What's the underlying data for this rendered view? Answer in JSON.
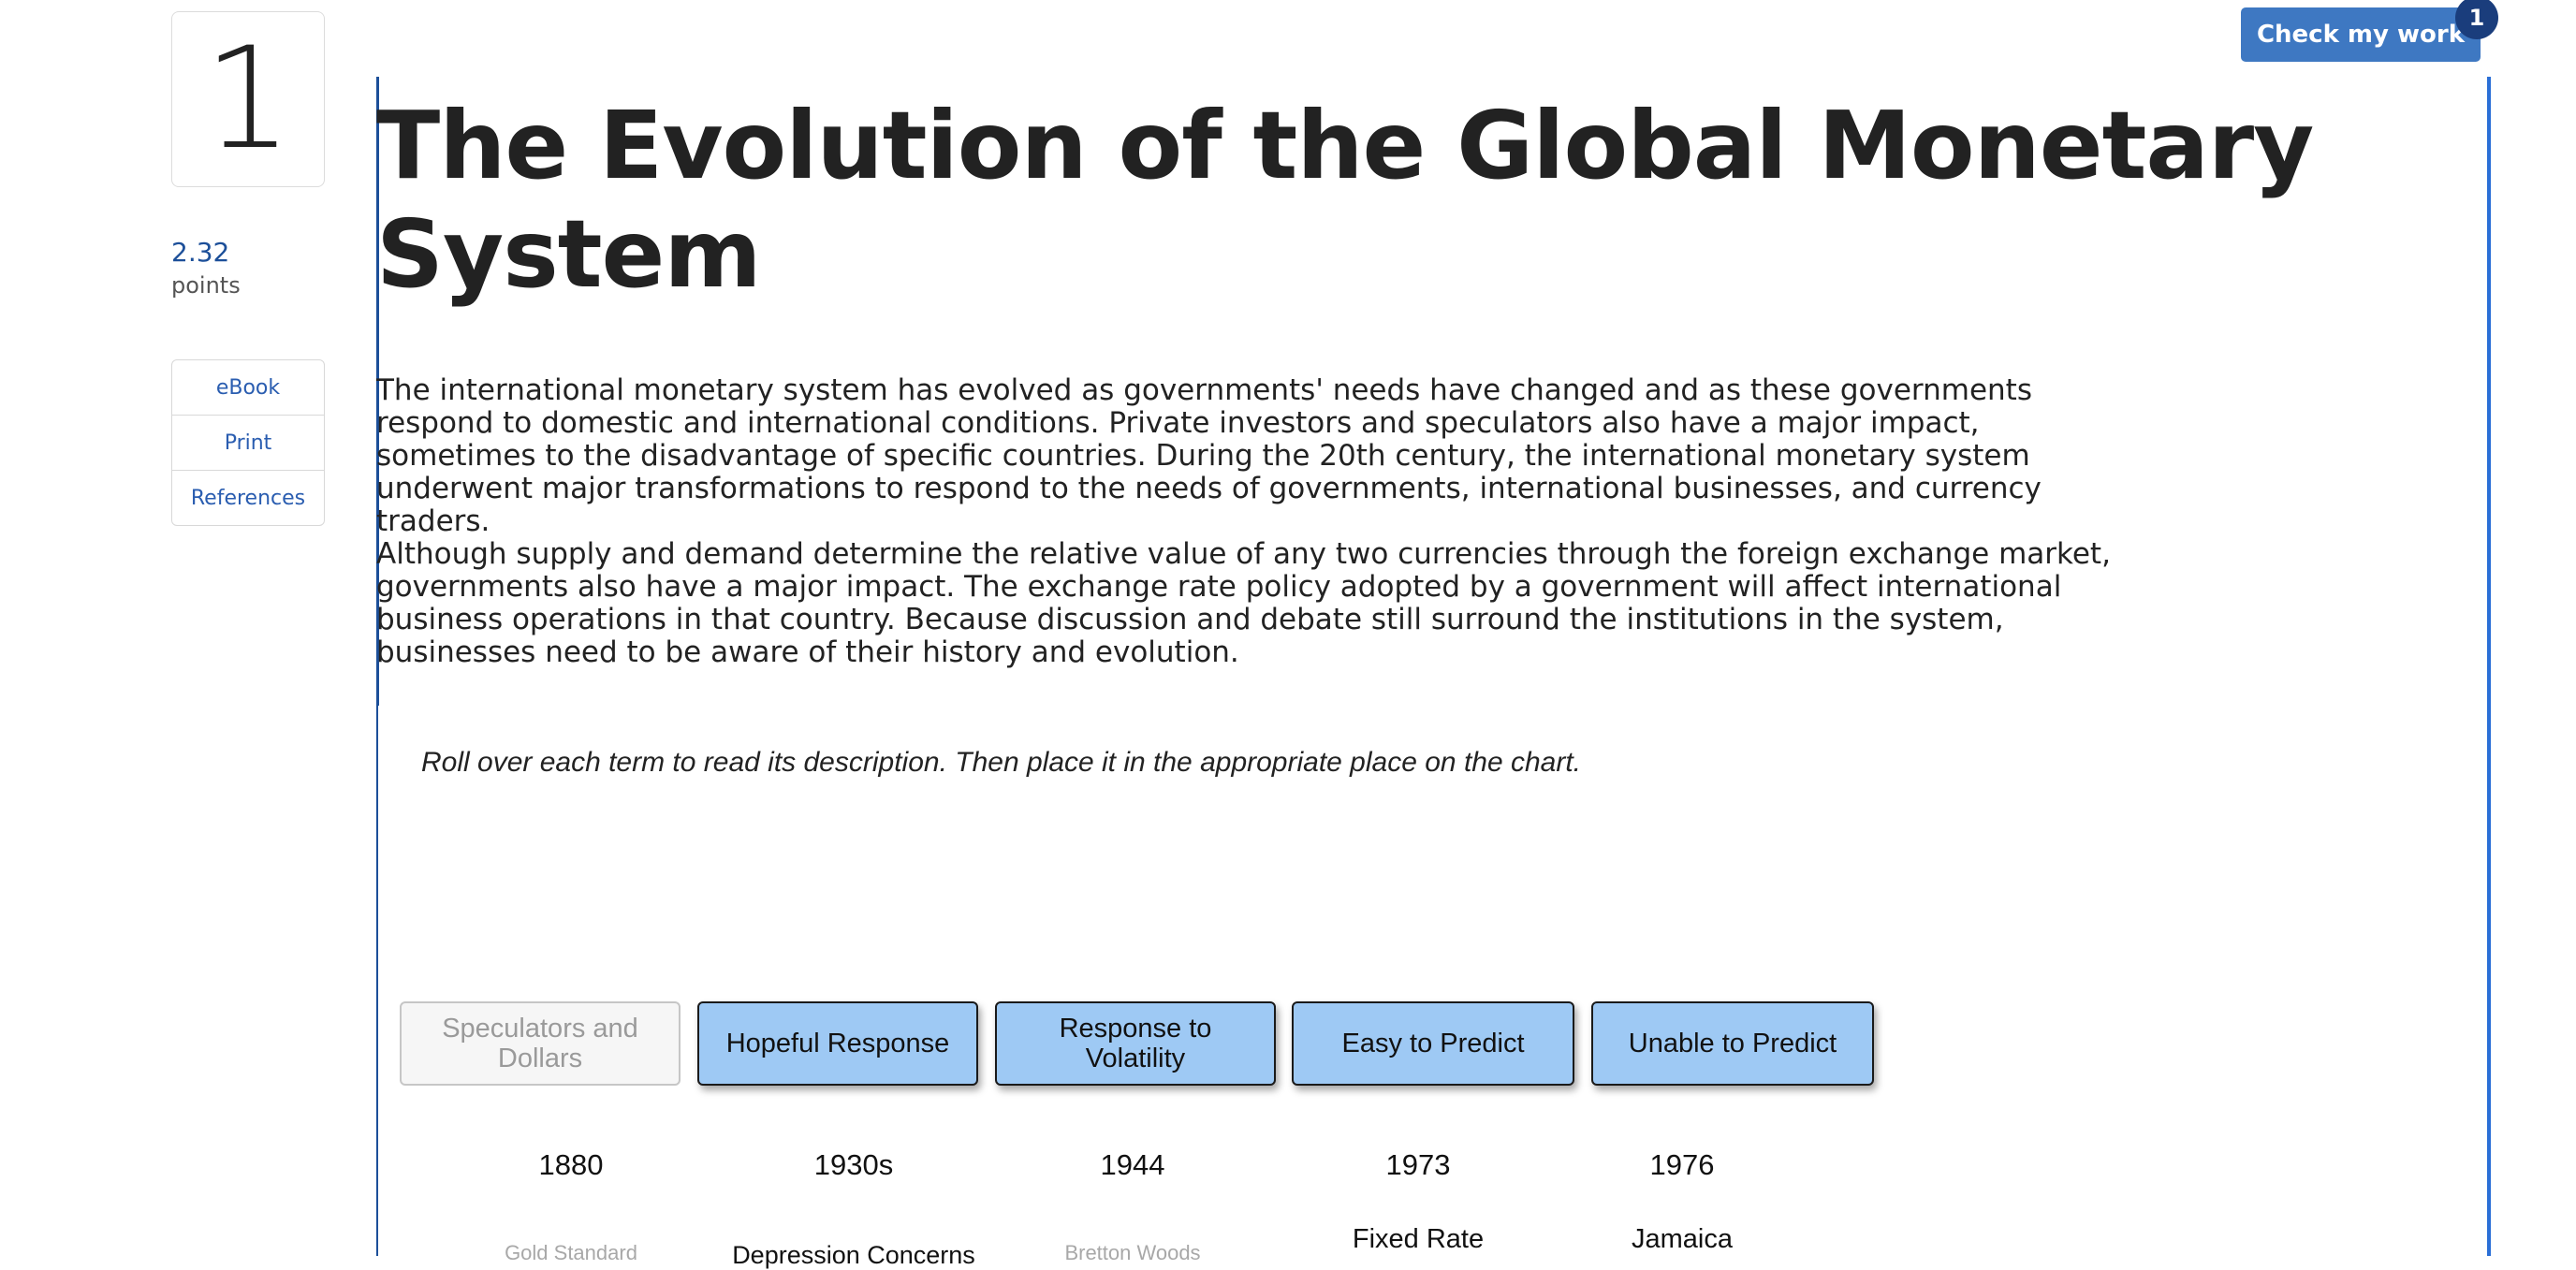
{
  "question": {
    "number": "1",
    "points_value": "2.32",
    "points_label": "points"
  },
  "tools": [
    "eBook",
    "Print",
    "References"
  ],
  "header": {
    "check_button": "Check my work",
    "check_badge": "1"
  },
  "content": {
    "title": "The Evolution of the Global Monetary System",
    "paragraph1": "The international monetary system has evolved as governments' needs have changed and as these governments respond to domestic and international conditions. Private investors and speculators also have a major impact, sometimes to the disadvantage of specific countries. During the 20th century, the international monetary system underwent major transformations to respond to the needs of governments, international businesses, and currency traders.",
    "paragraph2": "Although supply and demand determine the relative value of any two currencies through the foreign exchange market, governments also have a major impact. The exchange rate policy adopted by a government will affect international business operations in that country. Because discussion and debate still surround the institutions in the system, businesses need to be aware of their history and evolution.",
    "instructions": "Roll over each term to read its description. Then place it in the appropriate place on the chart."
  },
  "terms": [
    {
      "label": "Speculators and Dollars",
      "state": "used"
    },
    {
      "label": "Hopeful Response",
      "state": "available"
    },
    {
      "label": "Response to Volatility",
      "state": "available"
    },
    {
      "label": "Easy to Predict",
      "state": "available"
    },
    {
      "label": "Unable to Predict",
      "state": "available"
    }
  ],
  "timeline": {
    "years": [
      "1880",
      "1930s",
      "1944",
      "1973",
      "1976"
    ],
    "slot_labels": [
      "Gold Standard",
      "Depression Concerns",
      "Bretton Woods",
      "Fixed Rate",
      "Jamaica"
    ]
  }
}
